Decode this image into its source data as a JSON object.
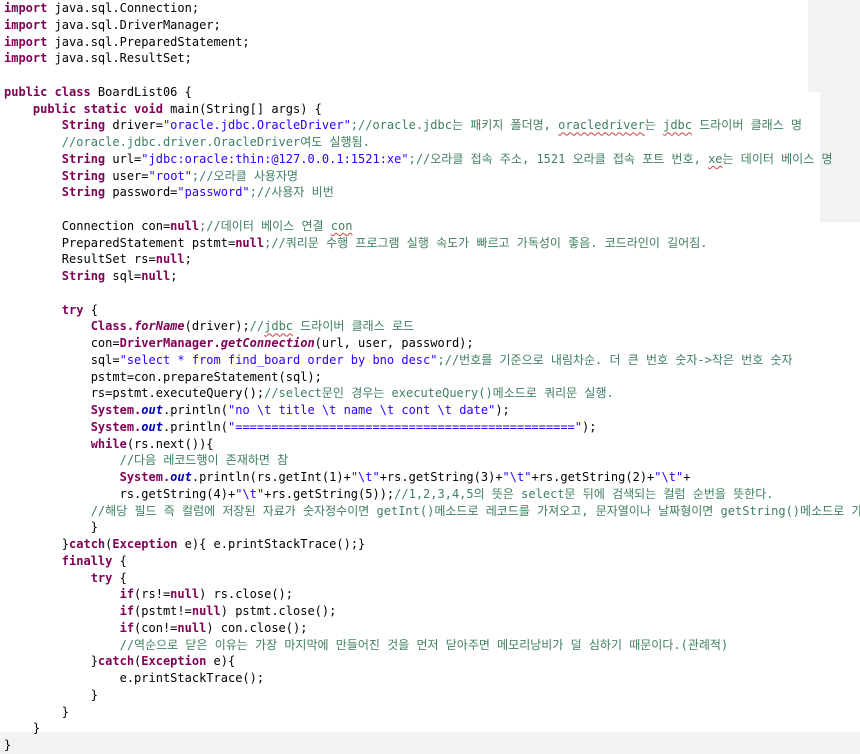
{
  "code_lines": [
    [
      {
        "t": "import",
        "c": "kw"
      },
      {
        "t": " java.sql.Connection;"
      }
    ],
    [
      {
        "t": "import",
        "c": "kw"
      },
      {
        "t": " java.sql.DriverManager;"
      }
    ],
    [
      {
        "t": "import",
        "c": "kw"
      },
      {
        "t": " java.sql.PreparedStatement;"
      }
    ],
    [
      {
        "t": "import",
        "c": "kw"
      },
      {
        "t": " java.sql.ResultSet;"
      }
    ],
    [],
    [
      {
        "t": "public class",
        "c": "kw"
      },
      {
        "t": " BoardList06 {"
      }
    ],
    [
      {
        "t": "    "
      },
      {
        "t": "public static void",
        "c": "kw"
      },
      {
        "t": " main(String[] args) {"
      }
    ],
    [
      {
        "t": "        "
      },
      {
        "t": "String",
        "c": "kw"
      },
      {
        "t": " driver="
      },
      {
        "t": "\"oracle.jdbc.OracleDriver\"",
        "c": "st"
      },
      {
        "t": ";//oracle.jdbc는 패키지 폴더명, ",
        "c": "cm"
      },
      {
        "t": "oracledriver",
        "c": "cm sq"
      },
      {
        "t": "는 ",
        "c": "cm"
      },
      {
        "t": "jdbc",
        "c": "cm sq"
      },
      {
        "t": " 드라이버 클래스 명",
        "c": "cm"
      }
    ],
    [
      {
        "t": "        "
      },
      {
        "t": "//oracle.jdbc.driver.OracleDriver여도 실행됨.",
        "c": "cm"
      }
    ],
    [
      {
        "t": "        "
      },
      {
        "t": "String",
        "c": "kw"
      },
      {
        "t": " url="
      },
      {
        "t": "\"jdbc:oracle:thin:@127.0.0.1:1521:xe\"",
        "c": "st"
      },
      {
        "t": ";//오라클 접속 주소, 1521 오라클 접속 포트 번호, ",
        "c": "cm"
      },
      {
        "t": "xe",
        "c": "cm sq"
      },
      {
        "t": "는 데이터 베이스 명",
        "c": "cm"
      }
    ],
    [
      {
        "t": "        "
      },
      {
        "t": "String",
        "c": "kw"
      },
      {
        "t": " user="
      },
      {
        "t": "\"root\"",
        "c": "st"
      },
      {
        "t": ";//오라클 사용자명",
        "c": "cm"
      }
    ],
    [
      {
        "t": "        "
      },
      {
        "t": "String",
        "c": "kw"
      },
      {
        "t": " password="
      },
      {
        "t": "\"password\"",
        "c": "st"
      },
      {
        "t": ";//사용자 비번",
        "c": "cm"
      }
    ],
    [],
    [
      {
        "t": "        Connection con="
      },
      {
        "t": "null",
        "c": "kw"
      },
      {
        "t": ";//데이터 베이스 연결 ",
        "c": "cm"
      },
      {
        "t": "con",
        "c": "cm sq"
      }
    ],
    [
      {
        "t": "        PreparedStatement pstmt="
      },
      {
        "t": "null",
        "c": "kw"
      },
      {
        "t": ";//쿼리문 수행 프로그램 실행 속도가 빠르고 가독성이 좋음. 코드라인이 길어짐.",
        "c": "cm"
      }
    ],
    [
      {
        "t": "        ResultSet rs="
      },
      {
        "t": "null",
        "c": "kw"
      },
      {
        "t": ";"
      }
    ],
    [
      {
        "t": "        "
      },
      {
        "t": "String",
        "c": "kw"
      },
      {
        "t": " sql="
      },
      {
        "t": "null",
        "c": "kw"
      },
      {
        "t": ";"
      }
    ],
    [],
    [
      {
        "t": "        "
      },
      {
        "t": "try",
        "c": "kw"
      },
      {
        "t": " {"
      }
    ],
    [
      {
        "t": "            "
      },
      {
        "t": "Class.",
        "c": "kw"
      },
      {
        "t": "forName",
        "c": "kw mt"
      },
      {
        "t": "(driver);"
      },
      {
        "t": "//",
        "c": "cm"
      },
      {
        "t": "jdbc",
        "c": "cm sq"
      },
      {
        "t": " 드라이버 클래스 로드",
        "c": "cm"
      }
    ],
    [
      {
        "t": "            con="
      },
      {
        "t": "DriverManager.",
        "c": "kw"
      },
      {
        "t": "getConnection",
        "c": "kw mt"
      },
      {
        "t": "(url, user, password);"
      }
    ],
    [
      {
        "t": "            sql="
      },
      {
        "t": "\"select * from find_board order by bno desc\"",
        "c": "st"
      },
      {
        "t": ";//번호를 기준으로 내림차순. 더 큰 번호 숫자->작은 번호 숫자",
        "c": "cm"
      }
    ],
    [
      {
        "t": "            pstmt=con.prepareStatement(sql);"
      }
    ],
    [
      {
        "t": "            rs=pstmt.executeQuery();"
      },
      {
        "t": "//select문인 경우는 executeQuery()메소드로 쿼리문 실행.",
        "c": "cm"
      }
    ],
    [
      {
        "t": "            "
      },
      {
        "t": "System.",
        "c": "kw"
      },
      {
        "t": "out",
        "c": "fd"
      },
      {
        "t": ".println("
      },
      {
        "t": "\"no \\t title \\t name \\t cont \\t date\"",
        "c": "st"
      },
      {
        "t": ");"
      }
    ],
    [
      {
        "t": "            "
      },
      {
        "t": "System.",
        "c": "kw"
      },
      {
        "t": "out",
        "c": "fd"
      },
      {
        "t": ".println("
      },
      {
        "t": "\"===============================================\"",
        "c": "st"
      },
      {
        "t": ");"
      }
    ],
    [
      {
        "t": "            "
      },
      {
        "t": "while",
        "c": "kw"
      },
      {
        "t": "(rs.next()){"
      }
    ],
    [
      {
        "t": "                "
      },
      {
        "t": "//다음 레코드행이 존재하면 참",
        "c": "cm"
      }
    ],
    [
      {
        "t": "                "
      },
      {
        "t": "System.",
        "c": "kw"
      },
      {
        "t": "out",
        "c": "fd"
      },
      {
        "t": ".println(rs.getInt(1)+"
      },
      {
        "t": "\"\\t\"",
        "c": "st"
      },
      {
        "t": "+rs.getString(3)+"
      },
      {
        "t": "\"\\t\"",
        "c": "st"
      },
      {
        "t": "+rs.getString(2)+"
      },
      {
        "t": "\"\\t\"",
        "c": "st"
      },
      {
        "t": "+"
      }
    ],
    [
      {
        "t": "                rs.getString(4)+"
      },
      {
        "t": "\"\\t\"",
        "c": "st"
      },
      {
        "t": "+rs.getString(5));"
      },
      {
        "t": "//1,2,3,4,5의 뜻은 select문 뒤에 검색되는 컬럼 순번을 뜻한다.",
        "c": "cm"
      }
    ],
    [
      {
        "t": "            "
      },
      {
        "t": "//해당 필드 즉 컬럼에 저장된 자료가 숫자정수이면 getInt()메소드로 레코드를 가져오고, 문자열이나 날짜형이면 getString()메소드로 가져온다.",
        "c": "cm"
      }
    ],
    [
      {
        "t": "            }"
      }
    ],
    [
      {
        "t": "        }"
      },
      {
        "t": "catch",
        "c": "kw"
      },
      {
        "t": "("
      },
      {
        "t": "Exception",
        "c": "kw"
      },
      {
        "t": " e){ e.printStackTrace();}"
      }
    ],
    [
      {
        "t": "        "
      },
      {
        "t": "finally",
        "c": "kw"
      },
      {
        "t": " {"
      }
    ],
    [
      {
        "t": "            "
      },
      {
        "t": "try",
        "c": "kw"
      },
      {
        "t": " {"
      }
    ],
    [
      {
        "t": "                "
      },
      {
        "t": "if",
        "c": "kw"
      },
      {
        "t": "(rs!="
      },
      {
        "t": "null",
        "c": "kw"
      },
      {
        "t": ") rs.close();"
      }
    ],
    [
      {
        "t": "                "
      },
      {
        "t": "if",
        "c": "kw"
      },
      {
        "t": "(pstmt!="
      },
      {
        "t": "null",
        "c": "kw"
      },
      {
        "t": ") pstmt.close();"
      }
    ],
    [
      {
        "t": "                "
      },
      {
        "t": "if",
        "c": "kw"
      },
      {
        "t": "(con!="
      },
      {
        "t": "null",
        "c": "kw"
      },
      {
        "t": ") con.close();"
      }
    ],
    [
      {
        "t": "                "
      },
      {
        "t": "//역순으로 닫은 이유는 가장 마지막에 만들어진 것을 먼저 닫아주면 메모리낭비가 덜 심하기 때문이다.(관례적)",
        "c": "cm"
      }
    ],
    [
      {
        "t": "            }"
      },
      {
        "t": "catch",
        "c": "kw"
      },
      {
        "t": "("
      },
      {
        "t": "Exception",
        "c": "kw"
      },
      {
        "t": " e){"
      }
    ],
    [
      {
        "t": "                e.printStackTrace();"
      }
    ],
    [
      {
        "t": "            }"
      }
    ],
    [
      {
        "t": "        }"
      }
    ],
    [
      {
        "t": "    }"
      }
    ],
    [
      {
        "t": "}"
      }
    ]
  ]
}
